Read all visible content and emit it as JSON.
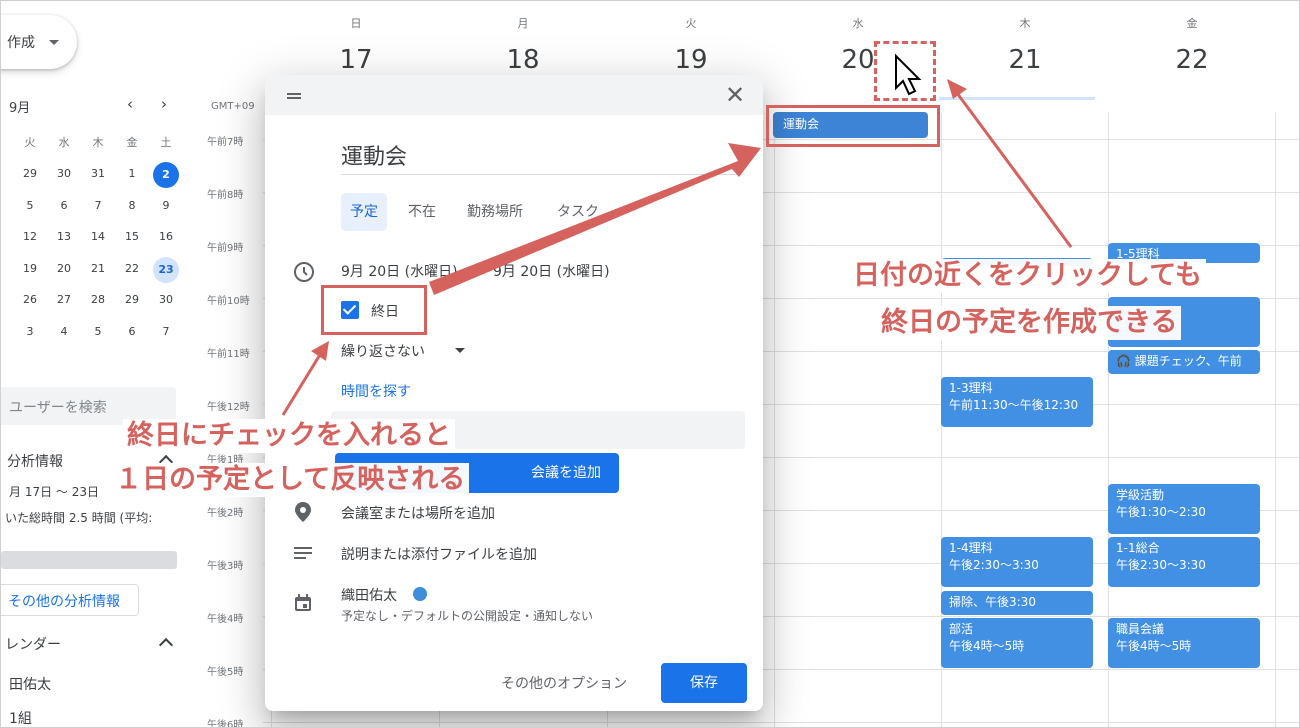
{
  "sidebar": {
    "create_label": "作成",
    "mini_month_title": "9月",
    "prev_icon": "chevron-left-icon",
    "next_icon": "chevron-right-icon",
    "weekday_headers": [
      "火",
      "水",
      "木",
      "金",
      "土"
    ],
    "weeks": [
      [
        "29",
        "30",
        "31",
        "1",
        "2"
      ],
      [
        "5",
        "6",
        "7",
        "8",
        "9"
      ],
      [
        "12",
        "13",
        "14",
        "15",
        "16"
      ],
      [
        "19",
        "20",
        "21",
        "22",
        "23"
      ],
      [
        "26",
        "27",
        "28",
        "29",
        "30"
      ],
      [
        "3",
        "4",
        "5",
        "6",
        "7"
      ]
    ],
    "today_date": "2",
    "selected_date": "23",
    "search_placeholder": "ユーザーを検索",
    "analysis_title": "分析情報",
    "analysis_range": "月 17日 〜 23日",
    "analysis_summary": "いた総時間 2.5 時間 (平均:",
    "analysis_more_button": "その他の分析情報",
    "calendars_title": "レンダー",
    "calendar_owner": "田佑太",
    "calendar_class": "1組"
  },
  "calendar": {
    "timezone": "GMT+09",
    "days": [
      {
        "dow": "日",
        "num": "17"
      },
      {
        "dow": "月",
        "num": "18"
      },
      {
        "dow": "火",
        "num": "19"
      },
      {
        "dow": "水",
        "num": "20"
      },
      {
        "dow": "木",
        "num": "21"
      },
      {
        "dow": "金",
        "num": "22"
      }
    ],
    "time_labels": [
      "午前7時",
      "午前8時",
      "午前9時",
      "午前10時",
      "午前11時",
      "午後12時",
      "午後1時",
      "午後2時",
      "午後3時",
      "午後4時",
      "午後5時",
      "午後6時"
    ],
    "allday_event": "運動会",
    "events": {
      "e1": "1-5理科",
      "e2": "課題チェック、午前",
      "e3_title": "1-3理科",
      "e3_time": "午前11:30〜午後12:30",
      "e4_title": "学級活動",
      "e4_time": "午後1:30〜2:30",
      "e5_title": "1-4理科",
      "e5_time": "午後2:30〜3:30",
      "e6_title": "1-1総合",
      "e6_time": "午後2:30〜3:30",
      "e7": "掃除、午後3:30",
      "e8_title": "部活",
      "e8_time": "午後4時〜5時",
      "e9_title": "職員会議",
      "e9_time": "午後4時〜5時"
    }
  },
  "dialog": {
    "title_value": "運動会",
    "tabs": [
      "予定",
      "不在",
      "勤務場所",
      "タスク"
    ],
    "date_text": "9月 20日 (水曜日)",
    "date_end_text": "9月 20日 (水曜日)",
    "allday_label": "終日",
    "allday_checked": true,
    "repeat_label": "繰り返さない",
    "find_time_label": "時間を探す",
    "meet_button": "会議を追加",
    "location_placeholder": "会議室または場所を追加",
    "description_placeholder": "説明または添付ファイルを追加",
    "owner_name": "織田佑太",
    "owner_details": "予定なし・デフォルトの公開設定・通知しない",
    "more_options": "その他のオプション",
    "save_label": "保存"
  },
  "annotations": {
    "right_line1": "日付の近くをクリックしても",
    "right_line2": "終日の予定を作成できる",
    "left_line1": "終日にチェックを入れると",
    "left_line2": "１日の予定として反映される",
    "color": "#d6625e"
  },
  "colors": {
    "event_blue": "#4290e4",
    "primary_blue": "#1a73e8",
    "annotation_red": "#d6625e"
  }
}
